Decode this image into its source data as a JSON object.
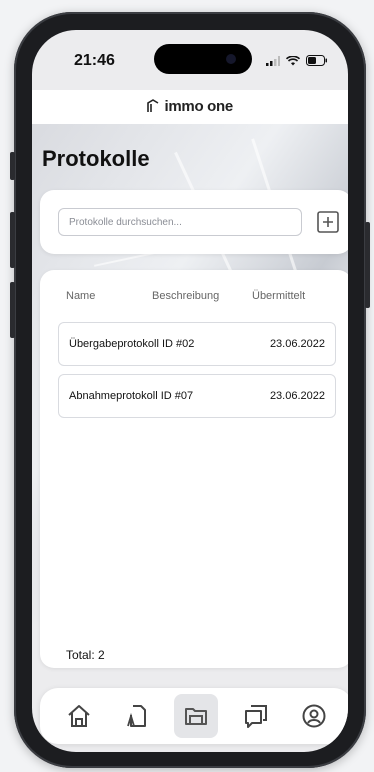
{
  "status_bar": {
    "time": "21:46"
  },
  "brand": {
    "logo": "immo one"
  },
  "page": {
    "title": "Protokolle"
  },
  "search": {
    "placeholder": "Protokolle durchsuchen...",
    "value": ""
  },
  "table": {
    "headers": {
      "name": "Name",
      "description": "Beschreibung",
      "submitted": "Übermittelt"
    },
    "rows": [
      {
        "name": "Übergabeprotokoll ID #02",
        "date": "23.06.2022"
      },
      {
        "name": "Abnahmeprotokoll ID #07",
        "date": "23.06.2022"
      }
    ],
    "total": "Total: 2"
  },
  "tabbar": {
    "items": [
      {
        "icon": "home-icon",
        "active": false
      },
      {
        "icon": "document-icon",
        "active": false
      },
      {
        "icon": "folder-icon",
        "active": true
      },
      {
        "icon": "chat-icon",
        "active": false
      },
      {
        "icon": "profile-icon",
        "active": false
      }
    ]
  },
  "colors": {
    "icon": "#444444",
    "active_tab_bg": "#e4e5e8",
    "background": "#ececee"
  }
}
